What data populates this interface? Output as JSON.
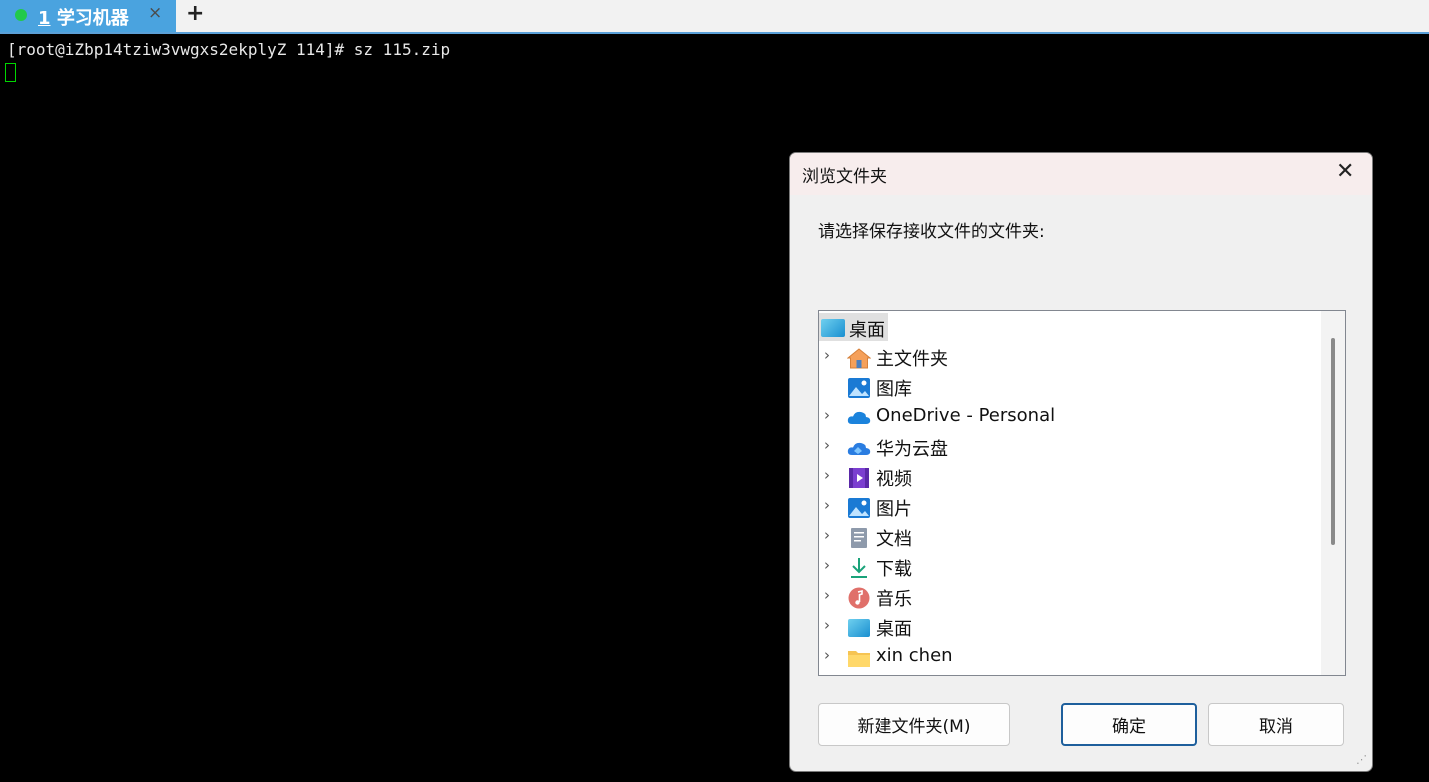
{
  "tab": {
    "number": "1",
    "title": "学习机器",
    "close": "×",
    "new_tab": "+"
  },
  "terminal": {
    "line": "[root@iZbp14tziw3vwgxs2ekplyZ 114]# sz 115.zip"
  },
  "dialog": {
    "title": "浏览文件夹",
    "close": "✕",
    "prompt": "请选择保存接收文件的文件夹:",
    "root": "桌面",
    "items": [
      {
        "label": "主文件夹",
        "icon": "home-icon",
        "expandable": true
      },
      {
        "label": "图库",
        "icon": "gallery-icon",
        "expandable": false
      },
      {
        "label": "OneDrive - Personal",
        "icon": "onedrive-icon",
        "expandable": true
      },
      {
        "label": "华为云盘",
        "icon": "huawei-cloud-icon",
        "expandable": true
      },
      {
        "label": "视频",
        "icon": "video-icon",
        "expandable": true
      },
      {
        "label": "图片",
        "icon": "pictures-icon",
        "expandable": true
      },
      {
        "label": "文档",
        "icon": "documents-icon",
        "expandable": true
      },
      {
        "label": "下载",
        "icon": "download-icon",
        "expandable": true
      },
      {
        "label": "音乐",
        "icon": "music-icon",
        "expandable": true
      },
      {
        "label": "桌面",
        "icon": "desktop-icon",
        "expandable": true
      },
      {
        "label": "xin chen",
        "icon": "folder-icon",
        "expandable": true
      }
    ],
    "buttons": {
      "new_folder": "新建文件夹(M)",
      "ok": "确定",
      "cancel": "取消"
    }
  },
  "colors": {
    "tab_active": "#4aa3df",
    "status_dot": "#22c94a",
    "cursor": "#00d600",
    "ok_border": "#1e5f9c"
  }
}
